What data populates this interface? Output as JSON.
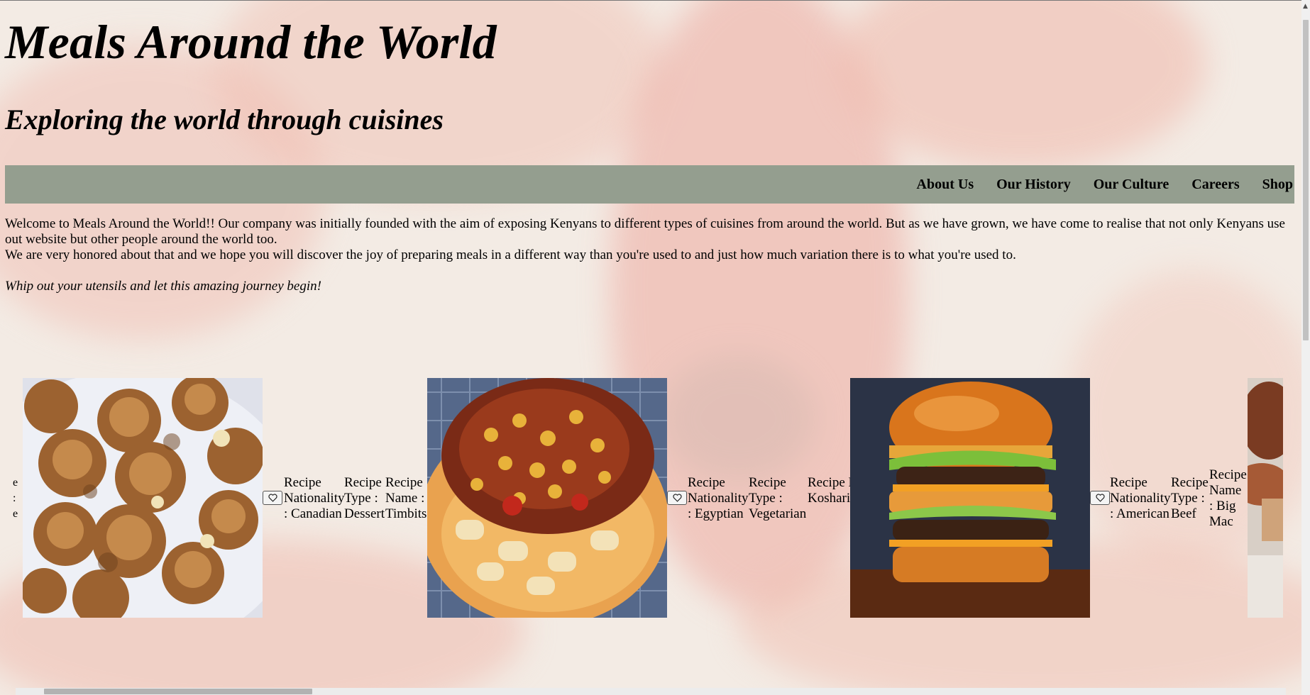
{
  "header": {
    "title": "Meals Around the World",
    "subtitle": "Exploring the world through cuisines"
  },
  "nav": {
    "items": [
      "About Us",
      "Our History",
      "Our Culture",
      "Careers",
      "Shop"
    ]
  },
  "intro": {
    "paragraph1": "Welcome to Meals Around the World!! Our company was initially founded with the aim of exposing Kenyans to different types of cuisines from around the world. But as we have grown, we have come to realise that not only Kenyans use out website but other people around the world too.",
    "paragraph2": "We are very honored about that and we hope you will discover the joy of preparing meals in a different way than you're used to and just how much variation there is to what you're used to.",
    "tagline": "Whip out your utensils and let this amazing journey begin!"
  },
  "recipes": [
    {
      "image": "timbits-photo",
      "nationality_label": "Recipe Nationality",
      "nationality": ": Canadian",
      "type_label": "Recipe Type :",
      "type": "Dessert",
      "name_label": "Recipe Name :",
      "name": "Timbits"
    },
    {
      "image": "koshari-photo",
      "nationality_label": "Recipe Nationality",
      "nationality": ": Egyptian",
      "type_label": "Recipe Type :",
      "type": "Vegetarian",
      "name_label": "Recipe Name :",
      "name": "Koshari"
    },
    {
      "image": "big-mac-photo",
      "nationality_label": "Recipe Nationality",
      "nationality": ": American",
      "type_label": "Recipe Type :",
      "type": "Beef",
      "name_label": "Recipe Name",
      "name": ": Big Mac"
    }
  ],
  "partial_left_text": [
    "e",
    ":",
    "e"
  ],
  "icons": {
    "favorite": "heart-icon"
  },
  "colors": {
    "nav_background": "#949e8f",
    "page_background": "#f3ebe4",
    "watercolor_accent": "#eeaaa0"
  }
}
